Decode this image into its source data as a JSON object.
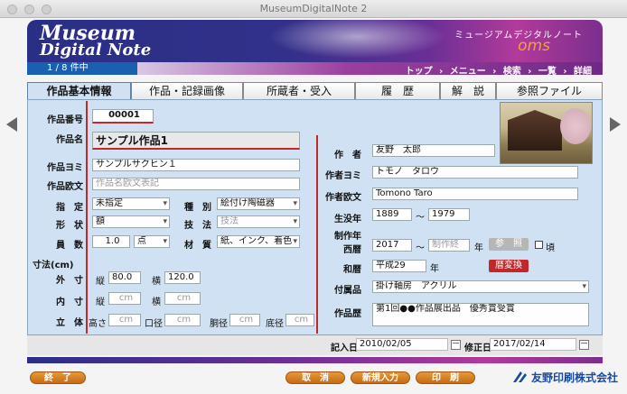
{
  "window": {
    "title": "MuseumDigitalNote 2"
  },
  "header": {
    "logo_line1": "Museum",
    "logo_line2": "Digital Note",
    "jp_subtitle": "ミュージアムデジタルノート",
    "brand": "oms"
  },
  "nav": {
    "record_count": "1 / 8 件中",
    "links": [
      "トップ",
      "›",
      "メニュー",
      "›",
      "検索",
      "›",
      "一覧",
      "›",
      "詳細"
    ]
  },
  "tabs": [
    "作品基本情報",
    "作品・記録画像",
    "所蔵者・受入",
    "履　歴",
    "解　説",
    "参照ファイル"
  ],
  "form": {
    "labels": {
      "number": "作品番号",
      "name": "作品名",
      "yomi": "作品ヨミ",
      "roman": "作品欧文",
      "designation": "指　定",
      "shape": "形　状",
      "quantity": "員　数",
      "category": "種　別",
      "technique": "技　法",
      "material": "材　質",
      "dimensions": "寸法(cm)",
      "outer": "外　寸",
      "inner": "内　寸",
      "solid": "立　体",
      "author": "作　者",
      "author_yomi": "作者ヨミ",
      "author_roman": "作者欧文",
      "life": "生没年",
      "year_label_1": "制作年",
      "year_label_2": "西暦",
      "wareki": "和暦",
      "accessory": "付属品",
      "history": "作品歴"
    },
    "values": {
      "number": "00001",
      "name": "サンプル作品1",
      "yomi": "サンプルサクヒン１",
      "roman_placeholder": "作品名欧文表記",
      "designation": "未指定",
      "shape": "額",
      "quantity": "1.0",
      "quantity_unit": "点",
      "category": "絵付け陶磁器",
      "technique_placeholder": "技法",
      "material": "紙、インク、着色",
      "outer_h_label": "縦",
      "outer_h": "80.0",
      "outer_w_label": "横",
      "outer_w": "120.0",
      "inner_h_label": "縦",
      "inner_w_label": "横",
      "cm": "cm",
      "solid_labels": [
        "高さ",
        "口径",
        "胴径",
        "底径"
      ],
      "author": "友野　太郎",
      "author_yomi": "トモノ　タロウ",
      "author_roman": "Tomono Taro",
      "birth": "1889",
      "death": "1979",
      "tilde": "〜",
      "year": "2017",
      "year_end_placeholder": "制作終",
      "year_suffix": "年",
      "ref_button": "参　照",
      "circa": "頃",
      "wareki": "平成29",
      "wareki_suffix": "年",
      "convert_button": "暦変換",
      "accessory": "掛け軸房　アクリル",
      "history": "第1回●●作品展出品　優秀賞受賞"
    }
  },
  "footer": {
    "entry_label": "記入日",
    "entry_date": "2010/02/05",
    "modify_label": "修正日",
    "modify_date": "2017/02/14",
    "exit_button": "終　了",
    "cancel_button": "取　消",
    "new_button": "新規入力",
    "print_button": "印　刷",
    "company": "友野印刷株式会社"
  },
  "colors": {
    "accent_blue": "#1a5fb0",
    "accent_red": "#c0282a",
    "panel_bg": "#cfe1f2",
    "button_orange": "#d9822b"
  }
}
